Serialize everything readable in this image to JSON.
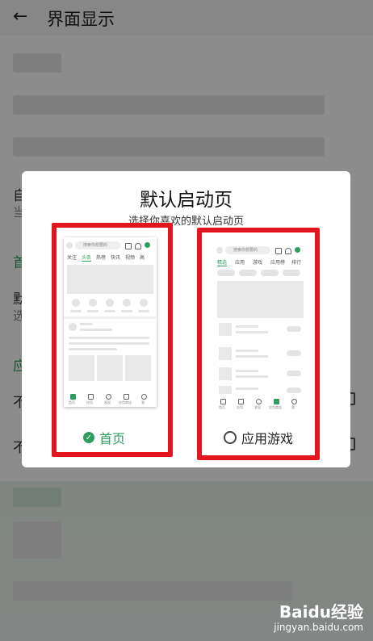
{
  "header": {
    "back_glyph": "←",
    "title": "界面显示"
  },
  "background_peek": {
    "row3_char": "自",
    "row3_sub_char": "当",
    "section1_char": "首",
    "row4_char": "默",
    "row4_sub_char": "选",
    "section2_char": "应",
    "row5_char": "不",
    "row6_char": "不"
  },
  "dialog": {
    "title": "默认启动页",
    "subtitle": "选择你喜欢的默认启动页",
    "options": [
      {
        "label": "首页",
        "selected": true
      },
      {
        "label": "应用游戏",
        "selected": false
      }
    ]
  },
  "preview_home": {
    "search_placeholder": "搜索你想要的",
    "tabs": [
      "关注",
      "头条",
      "热榜",
      "快讯",
      "视频",
      "高"
    ],
    "nav": [
      "首页",
      "应用",
      "发现",
      "应用商店",
      "我"
    ]
  },
  "preview_apps": {
    "search_placeholder": "搜索你想要的",
    "tabs": [
      "精选",
      "应用",
      "游戏",
      "应用榜",
      "排行"
    ],
    "nav": [
      "首页",
      "应用",
      "发现",
      "应用商店",
      "我"
    ]
  },
  "watermark": {
    "brand": "Baidu经验",
    "url": "jingyan.baidu.com"
  },
  "colors": {
    "accent": "#2e9e5e",
    "highlight_frame": "#e3161e"
  }
}
